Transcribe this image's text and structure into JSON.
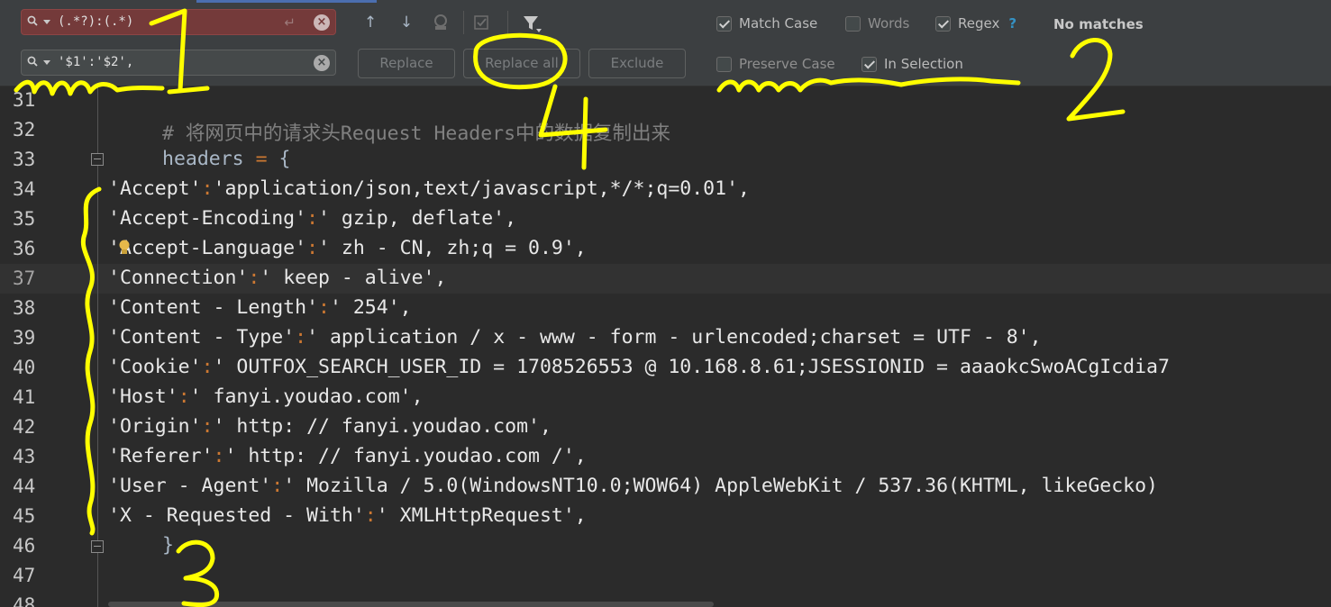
{
  "find_bar": {
    "search_value": "(.*?):(.*)",
    "replace_value": "'$1':'$2',",
    "buttons": {
      "replace": "Replace",
      "replace_all": "Replace all",
      "exclude": "Exclude"
    },
    "options": {
      "match_case": {
        "label": "Match Case",
        "checked": true
      },
      "words": {
        "label": "Words",
        "checked": false
      },
      "regex": {
        "label": "Regex",
        "checked": true
      },
      "regex_help": "?",
      "preserve_case": {
        "label": "Preserve Case",
        "checked": false
      },
      "in_selection": {
        "label": "In Selection",
        "checked": true
      }
    },
    "status": "No matches",
    "icons": [
      "search-history-icon",
      "enter-icon",
      "clear-icon",
      "previous-occurrence-icon",
      "next-occurrence-icon",
      "select-all-occurrences-icon",
      "filter-icon"
    ]
  },
  "editor": {
    "current_line": 37,
    "lines": [
      {
        "n": "31",
        "text": ""
      },
      {
        "n": "32",
        "text": "# 将网页中的请求头Request Headers中的数据复制出来",
        "kind": "comment"
      },
      {
        "n": "33",
        "text": "headers = {",
        "kind": "assign"
      },
      {
        "n": "34",
        "text": "'Accept':'application/json,text/javascript,*/*;q=0.01',"
      },
      {
        "n": "35",
        "text": "'Accept-Encoding':' gzip, deflate',"
      },
      {
        "n": "36",
        "text": "'Accept-Language':' zh - CN, zh;q = 0.9',"
      },
      {
        "n": "37",
        "text": "'Connection':' keep - alive',"
      },
      {
        "n": "38",
        "text": "'Content - Length':' 254',"
      },
      {
        "n": "39",
        "text": "'Content - Type':' application / x - www - form - urlencoded;charset = UTF - 8',"
      },
      {
        "n": "40",
        "text": "'Cookie':' OUTFOX_SEARCH_USER_ID = 1708526553 @ 10.168.8.61;JSESSIONID = aaaokcSwoACgIcdia7"
      },
      {
        "n": "41",
        "text": "'Host':' fanyi.youdao.com',"
      },
      {
        "n": "42",
        "text": "'Origin':' http: // fanyi.youdao.com',"
      },
      {
        "n": "43",
        "text": "'Referer':' http: // fanyi.youdao.com /',"
      },
      {
        "n": "44",
        "text": "'User - Agent':' Mozilla / 5.0(WindowsNT10.0;WOW64) AppleWebKit / 537.36(KHTML, likeGecko)"
      },
      {
        "n": "45",
        "text": "'X - Requested - With':' XMLHttpRequest',"
      },
      {
        "n": "46",
        "text": "}",
        "kind": "close"
      },
      {
        "n": "47",
        "text": ""
      },
      {
        "n": "48",
        "text": ""
      }
    ]
  },
  "annotations": [
    "1",
    "2",
    "3",
    "4"
  ],
  "colors": {
    "highlight": "#ffff00",
    "search_error_bg": "#743a3a",
    "panel_bg": "#3c3f41",
    "editor_bg": "#2b2b2b"
  }
}
